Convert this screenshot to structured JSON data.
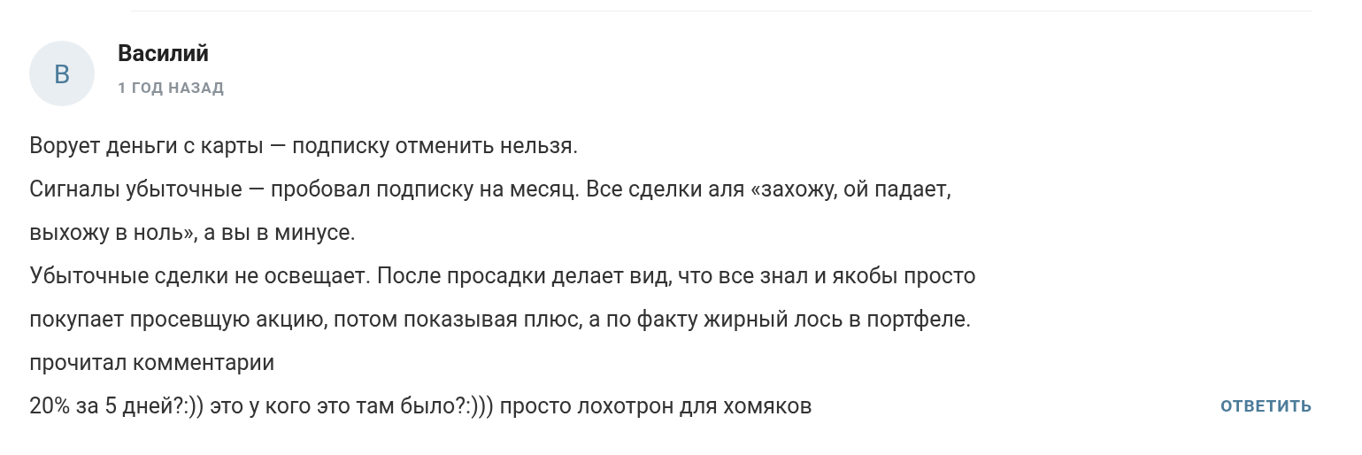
{
  "comment": {
    "avatar_letter": "В",
    "author": "Василий",
    "time": "1 ГОД НАЗАД",
    "lines": [
      "Ворует деньги с карты — подписку отменить нельзя.",
      "Сигналы убыточные — пробовал подписку на месяц. Все сделки аля «захожу, ой падает,",
      "выхожу в ноль», а вы в минусе.",
      "Убыточные сделки не освещает. После просадки делает вид, что все знал и якобы просто",
      "покупает просевщую акцию, потом показывая плюс, а по факту жирный лось в портфеле.",
      "прочитал комментарии",
      "20% за 5 дней?:)) это у кого это там было?:))) просто лохотрон для хомяков"
    ],
    "reply": "ОТВЕТИТЬ"
  }
}
